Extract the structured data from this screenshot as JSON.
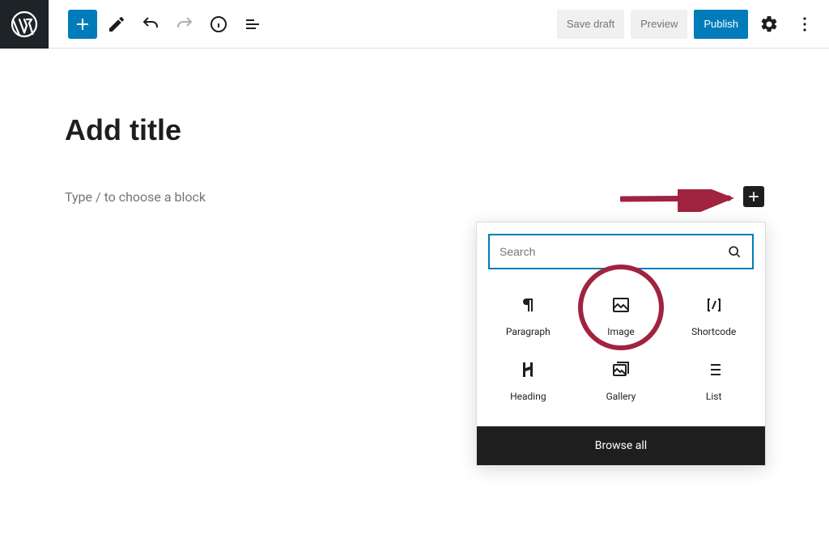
{
  "toolbar": {
    "save_draft": "Save draft",
    "preview": "Preview",
    "publish": "Publish"
  },
  "editor": {
    "title_placeholder": "Add title",
    "block_prompt": "Type / to choose a block"
  },
  "inserter": {
    "search_placeholder": "Search",
    "browse_all": "Browse all",
    "blocks": [
      {
        "label": "Paragraph"
      },
      {
        "label": "Image"
      },
      {
        "label": "Shortcode"
      },
      {
        "label": "Heading"
      },
      {
        "label": "Gallery"
      },
      {
        "label": "List"
      }
    ]
  },
  "colors": {
    "wp_blue": "#007cba",
    "annotation": "#a0233f"
  }
}
